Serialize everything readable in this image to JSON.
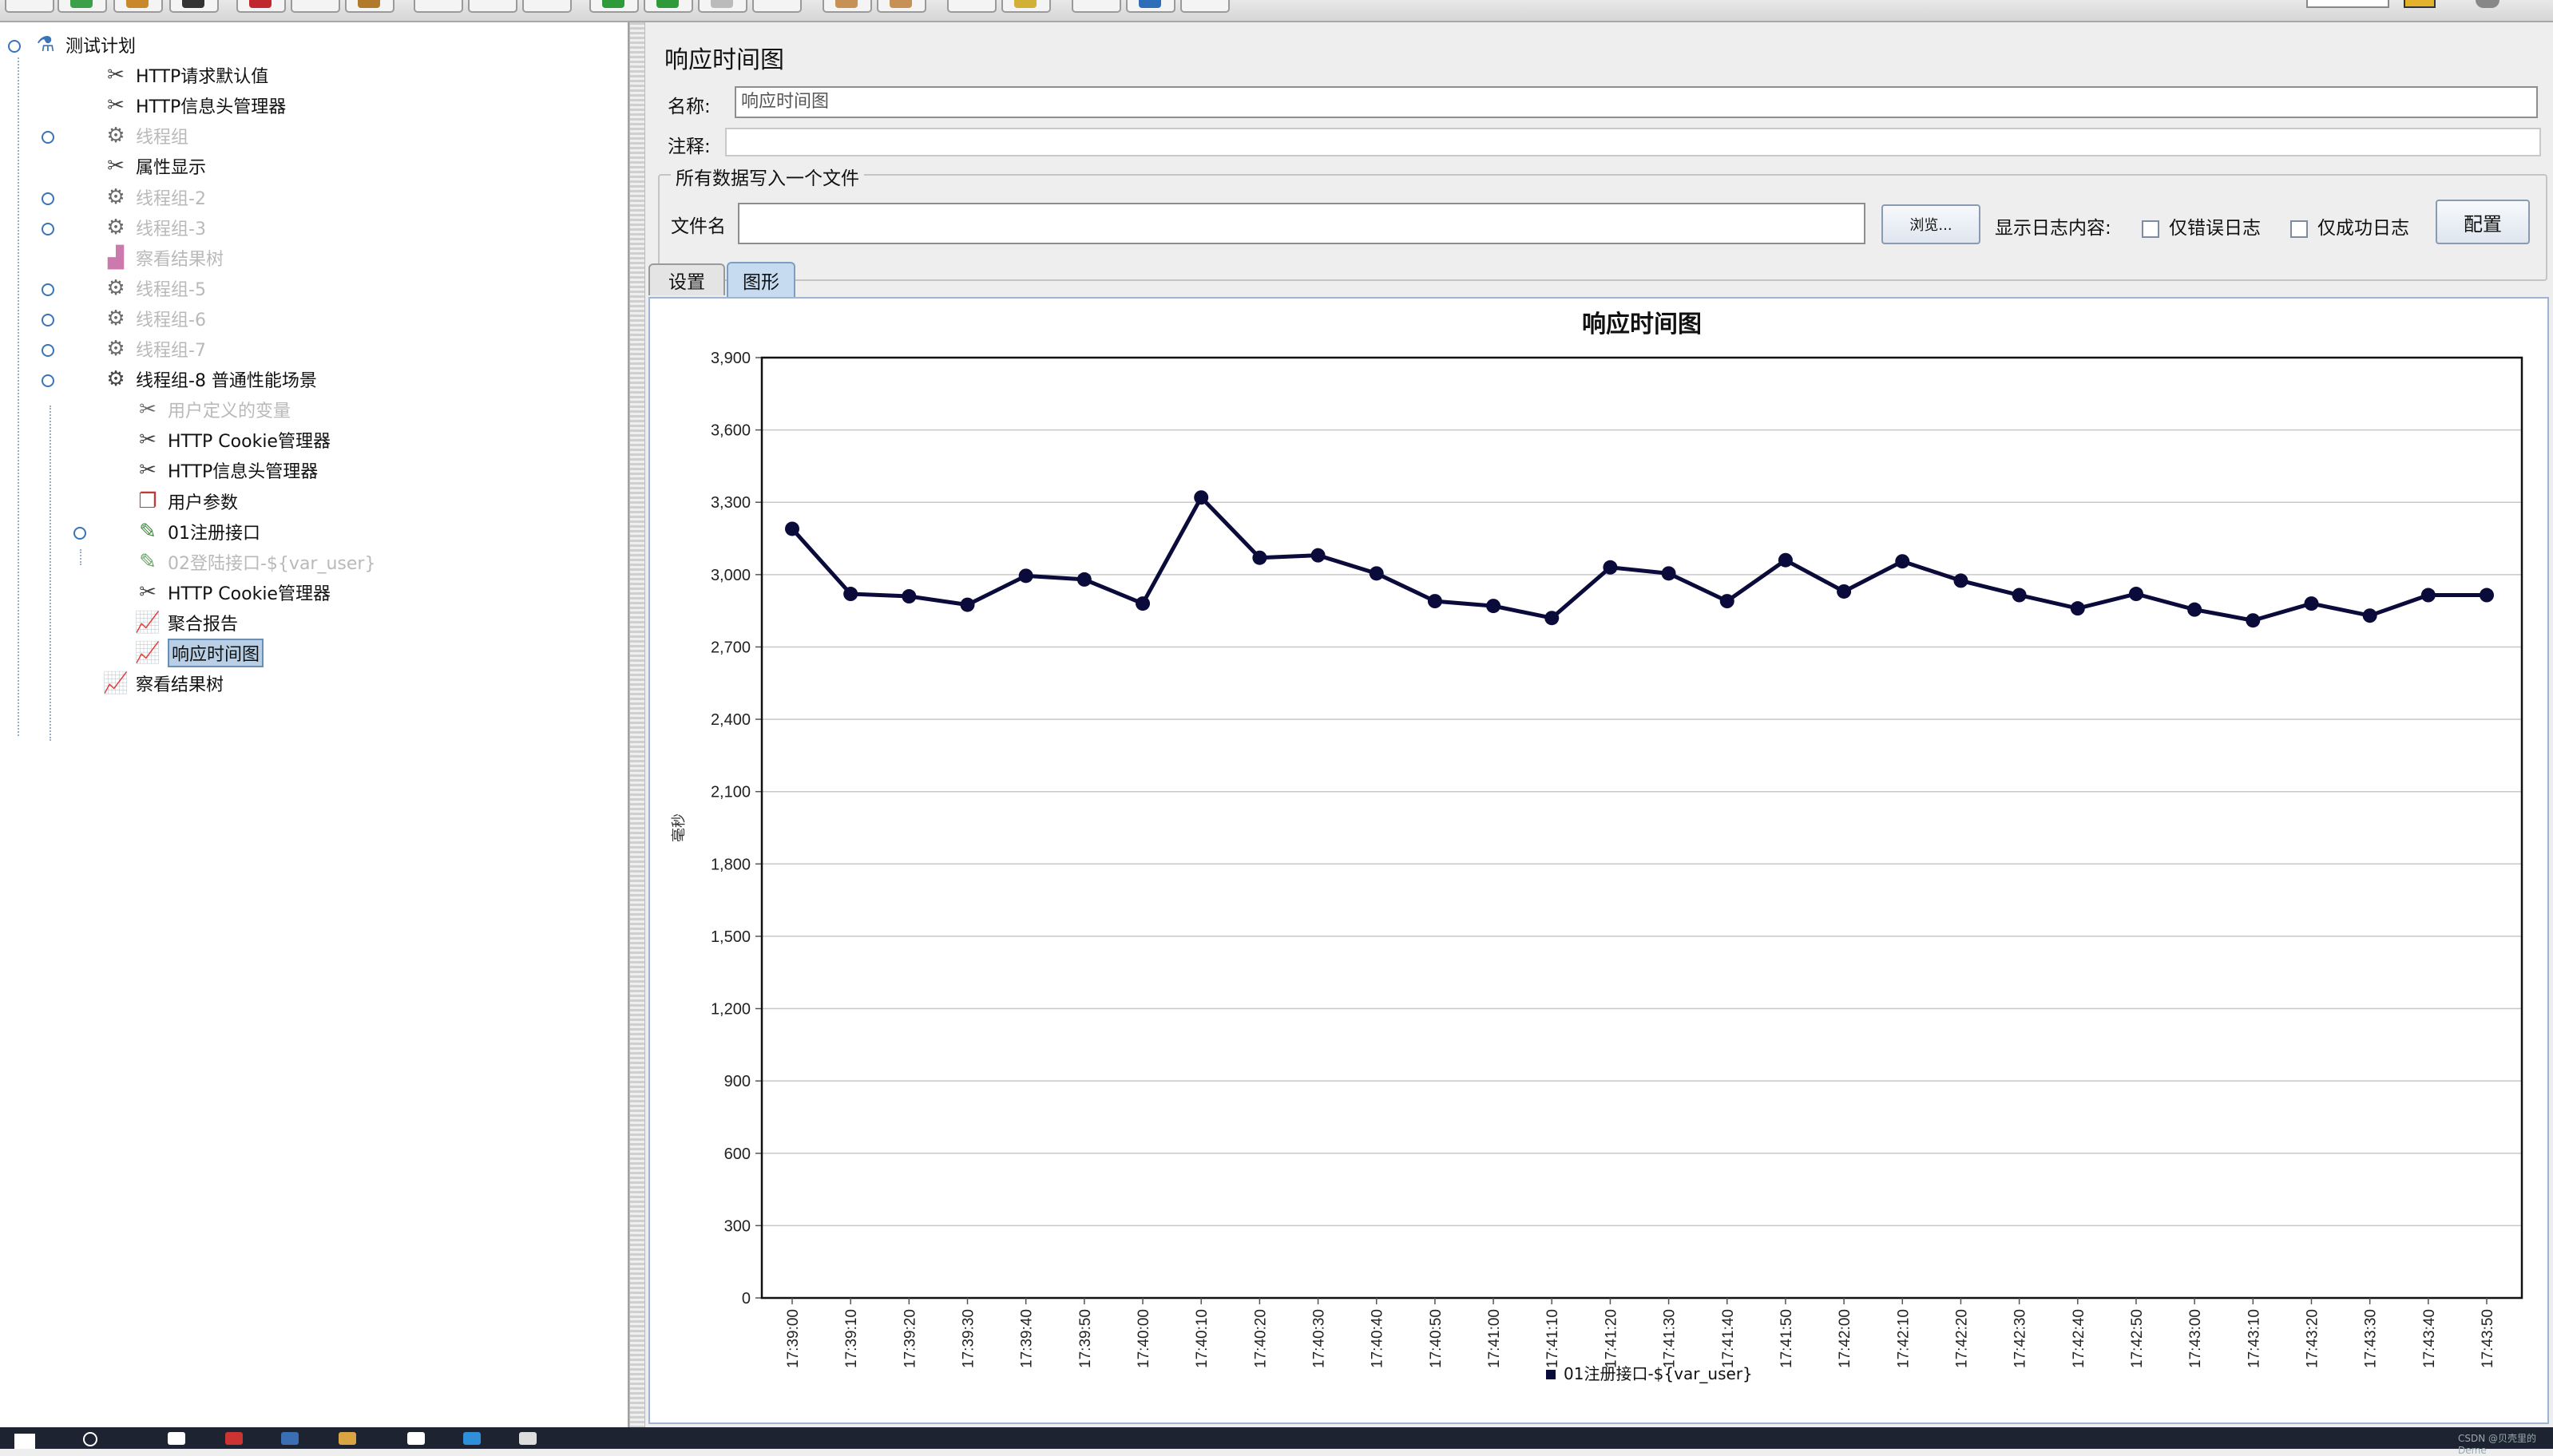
{
  "tree": {
    "items": [
      {
        "label": "测试计划",
        "icon": "flask-icon",
        "glyph": "⚗",
        "state": "normal"
      },
      {
        "label": "HTTP请求默认值",
        "icon": "tools-icon",
        "glyph": "✂",
        "state": "normal"
      },
      {
        "label": "HTTP信息头管理器",
        "icon": "tools-icon",
        "glyph": "✂",
        "state": "normal"
      },
      {
        "label": "线程组",
        "icon": "gear-icon",
        "glyph": "⚙",
        "state": "disabled"
      },
      {
        "label": "属性显示",
        "icon": "tools-icon",
        "glyph": "✂",
        "state": "normal"
      },
      {
        "label": "线程组-2",
        "icon": "gear-icon",
        "glyph": "⚙",
        "state": "disabled"
      },
      {
        "label": "线程组-3",
        "icon": "gear-icon",
        "glyph": "⚙",
        "state": "disabled"
      },
      {
        "label": "察看结果树",
        "icon": "graph-icon",
        "glyph": "▟",
        "state": "disabled"
      },
      {
        "label": "线程组-5",
        "icon": "gear-icon",
        "glyph": "⚙",
        "state": "disabled"
      },
      {
        "label": "线程组-6",
        "icon": "gear-icon",
        "glyph": "⚙",
        "state": "disabled"
      },
      {
        "label": "线程组-7",
        "icon": "gear-icon",
        "glyph": "⚙",
        "state": "disabled"
      },
      {
        "label": "线程组-8 普通性能场景",
        "icon": "gear-icon",
        "glyph": "⚙",
        "state": "normal"
      },
      {
        "label": "用户定义的变量",
        "icon": "tools-icon",
        "glyph": "✂",
        "state": "disabled"
      },
      {
        "label": "HTTP Cookie管理器",
        "icon": "tools-icon",
        "glyph": "✂",
        "state": "normal"
      },
      {
        "label": "HTTP信息头管理器",
        "icon": "tools-icon",
        "glyph": "✂",
        "state": "normal"
      },
      {
        "label": "用户参数",
        "icon": "document-icon",
        "glyph": "❐",
        "state": "normal"
      },
      {
        "label": "01注册接口",
        "icon": "pipette-icon",
        "glyph": "✎",
        "state": "normal"
      },
      {
        "label": "02登陆接口-${var_user}",
        "icon": "pipette-icon",
        "glyph": "✎",
        "state": "disabled"
      },
      {
        "label": "HTTP Cookie管理器",
        "icon": "tools-icon",
        "glyph": "✂",
        "state": "normal"
      },
      {
        "label": "聚合报告",
        "icon": "graph-icon",
        "glyph": "📈",
        "state": "normal"
      },
      {
        "label": "响应时间图",
        "icon": "graph-icon",
        "glyph": "📈",
        "state": "selected"
      },
      {
        "label": "察看结果树",
        "icon": "graph-icon",
        "glyph": "📈",
        "state": "normal"
      }
    ]
  },
  "panel": {
    "title": "响应时间图",
    "name_label": "名称:",
    "name_value": "响应时间图",
    "comment_label": "注释:",
    "comment_value": "",
    "file_group_title": "所有数据写入一个文件",
    "filename_label": "文件名",
    "filename_value": "",
    "browse_button": "浏览...",
    "log_content_label": "显示日志内容:",
    "errors_only_label": "仅错误日志",
    "success_only_label": "仅成功日志",
    "configure_button": "配置",
    "tabs": [
      "设置",
      "图形"
    ],
    "active_tab": "图形"
  },
  "chart_data": {
    "type": "line",
    "title": "响应时间图",
    "ylabel": "毫秒",
    "xlabel": "",
    "ylim": [
      0,
      3900
    ],
    "yticks": [
      0,
      300,
      600,
      900,
      1200,
      1500,
      1800,
      2100,
      2400,
      2700,
      3000,
      3300,
      3600,
      3900
    ],
    "ytick_labels": [
      "0",
      "300",
      "600",
      "900",
      "1,200",
      "1,500",
      "1,800",
      "2,100",
      "2,400",
      "2,700",
      "3,000",
      "3,300",
      "3,600",
      "3,900"
    ],
    "categories": [
      "17:39:00",
      "17:39:10",
      "17:39:20",
      "17:39:30",
      "17:39:40",
      "17:39:50",
      "17:40:00",
      "17:40:10",
      "17:40:20",
      "17:40:30",
      "17:40:40",
      "17:40:50",
      "17:41:00",
      "17:41:10",
      "17:41:20",
      "17:41:30",
      "17:41:40",
      "17:41:50",
      "17:42:00",
      "17:42:10",
      "17:42:20",
      "17:42:30",
      "17:42:40",
      "17:42:50",
      "17:43:00",
      "17:43:10",
      "17:43:20",
      "17:43:30",
      "17:43:40",
      "17:43:50"
    ],
    "series": [
      {
        "name": "01注册接口-${var_user}",
        "color": "#0b0b3b",
        "values": [
          3190,
          2920,
          2910,
          2875,
          2995,
          2980,
          2880,
          3320,
          3070,
          3080,
          3005,
          2890,
          2870,
          2820,
          3030,
          3005,
          2890,
          3060,
          2930,
          3055,
          2975,
          2915,
          2860,
          2920,
          2855,
          2810,
          2880,
          2830,
          2915,
          2915
        ]
      }
    ],
    "grid": true,
    "legend": "bottom"
  },
  "taskbar": {
    "colors": [
      "#ffffff",
      "#cc3333",
      "#3a6fb5",
      "#d9a441",
      "#ffffff",
      "#2f8fd8",
      "#dddddd",
      "#e08a2e"
    ]
  },
  "watermark": "CSDN @贝壳里的Deme"
}
